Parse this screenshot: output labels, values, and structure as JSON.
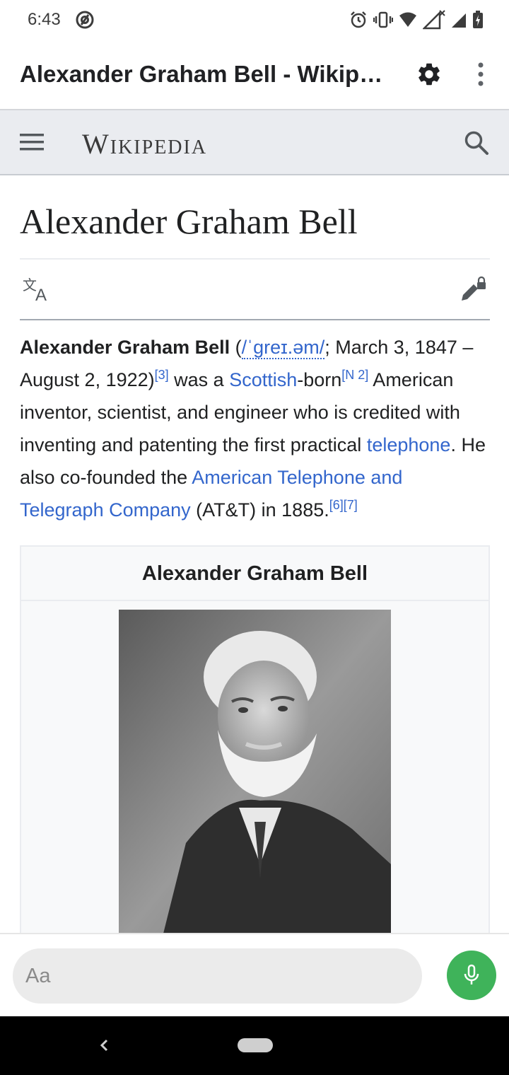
{
  "status_bar": {
    "time": "6:43",
    "icons": [
      "at-sign-icon",
      "alarm-icon",
      "vibrate-icon",
      "wifi-icon",
      "signal-x-icon",
      "signal-icon",
      "battery-charging-icon"
    ]
  },
  "app_bar": {
    "title": "Alexander Graham Bell - Wikipe…",
    "actions": [
      "gear-icon",
      "more-vert-icon"
    ]
  },
  "wiki_header": {
    "wordmark": "Wikipedia",
    "icons": [
      "hamburger-icon",
      "search-icon"
    ]
  },
  "article": {
    "title": "Alexander Graham Bell",
    "actions": [
      "translate-icon",
      "edit-lock-icon"
    ],
    "lead": {
      "subject": "Alexander Graham Bell",
      "open_paren": " (",
      "ipa": "/ˈɡreɪ.əm/",
      "dates": "; March 3, 1847 – August 2, 1922)",
      "ref_3": "[3]",
      "was_a": " was a ",
      "link_scottish": "Scottish",
      "born": "-born",
      "ref_n2": "[N 2]",
      "description": " American inventor, scientist, and engineer who is credited with inventing and patenting the first practical ",
      "link_telephone": "telephone",
      "cofounded": ". He also co-founded the ",
      "link_att": "American Telephone and Telegraph Company",
      "att_tail": " (AT&T) in 1885.",
      "ref_6": "[6]",
      "ref_7": "[7]"
    },
    "infobox": {
      "title": "Alexander Graham Bell"
    }
  },
  "input_bar": {
    "placeholder": "Aa",
    "mic_color": "#3fb35a"
  },
  "colors": {
    "link": "#3366cc",
    "wiki_header_bg": "#eaecf0",
    "infobox_bg": "#f8f9fa"
  }
}
